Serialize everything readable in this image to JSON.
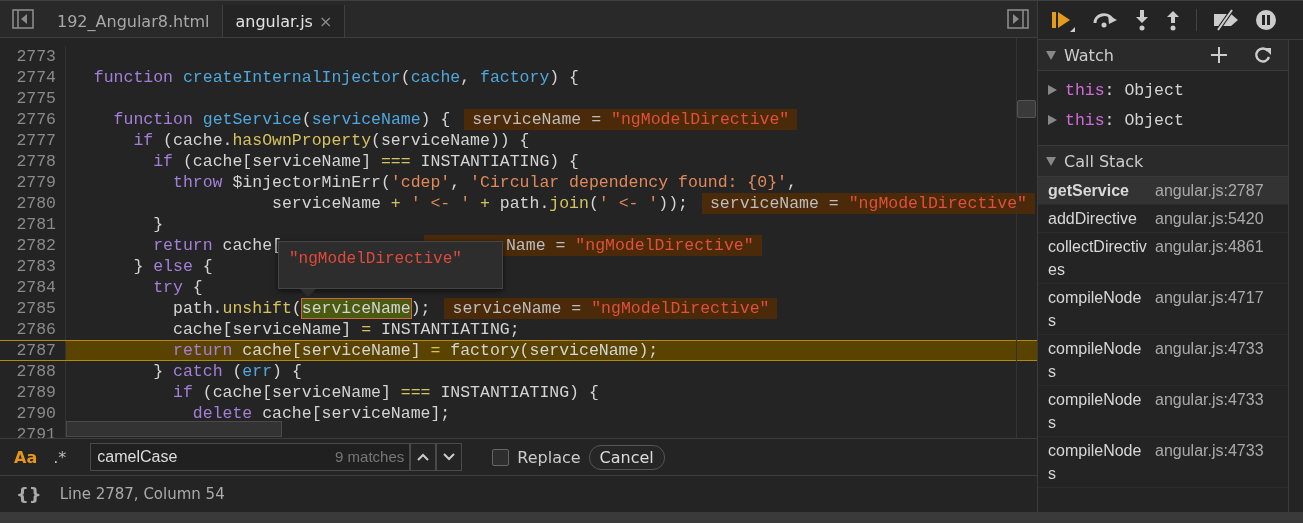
{
  "tabs": [
    {
      "label": "192_Angular8.html",
      "selected": false
    },
    {
      "label": "angular.js",
      "selected": true,
      "close": "×"
    }
  ],
  "editor": {
    "lines": [
      {
        "number": "2773"
      },
      {
        "number": "2774",
        "tokens": [
          {
            "kind": "kw",
            "text": "  function "
          },
          {
            "kind": "def",
            "text": "createInternalInjector"
          },
          {
            "kind": "plain",
            "text": "("
          },
          {
            "kind": "def",
            "text": "cache"
          },
          {
            "kind": "plain",
            "text": ", "
          },
          {
            "kind": "def",
            "text": "factory"
          },
          {
            "kind": "plain",
            "text": ") {"
          }
        ]
      },
      {
        "number": "2775"
      },
      {
        "number": "2776",
        "tokens": [
          {
            "kind": "kw",
            "text": "    function "
          },
          {
            "kind": "def",
            "text": "getService"
          },
          {
            "kind": "plain",
            "text": "("
          },
          {
            "kind": "def",
            "text": "serviceName"
          },
          {
            "kind": "plain",
            "text": ") {"
          }
        ],
        "inline_value": {
          "name": "serviceName =",
          "value": "\"ngModelDirective\"",
          "covered": false
        }
      },
      {
        "number": "2777",
        "tokens": [
          {
            "kind": "kw",
            "text": "      if"
          },
          {
            "kind": "plain",
            "text": " (cache."
          },
          {
            "kind": "method",
            "text": "hasOwnProperty"
          },
          {
            "kind": "plain",
            "text": "(serviceName)) {"
          }
        ]
      },
      {
        "number": "2778",
        "tokens": [
          {
            "kind": "kw",
            "text": "        if"
          },
          {
            "kind": "plain",
            "text": " (cache[serviceName] "
          },
          {
            "kind": "op",
            "text": "==="
          },
          {
            "kind": "plain",
            "text": " INSTANTIATING) {"
          }
        ]
      },
      {
        "number": "2779",
        "tokens": [
          {
            "kind": "kw",
            "text": "          throw"
          },
          {
            "kind": "plain",
            "text": " $injectorMinErr("
          },
          {
            "kind": "str",
            "text": "'cdep'"
          },
          {
            "kind": "plain",
            "text": ", "
          },
          {
            "kind": "str",
            "text": "'Circular dependency found: {0}'"
          },
          {
            "kind": "plain",
            "text": ","
          }
        ]
      },
      {
        "number": "2780",
        "tokens": [
          {
            "kind": "plain",
            "text": "                    serviceName "
          },
          {
            "kind": "op",
            "text": "+"
          },
          {
            "kind": "str",
            "text": " ' <- '"
          },
          {
            "kind": "op",
            "text": " +"
          },
          {
            "kind": "plain",
            "text": " path."
          },
          {
            "kind": "method",
            "text": "join"
          },
          {
            "kind": "plain",
            "text": "("
          },
          {
            "kind": "str",
            "text": "' <- '"
          },
          {
            "kind": "plain",
            "text": "));"
          }
        ],
        "inline_value": {
          "name": "serviceName =",
          "value": "\"ngModelDirective\"",
          "covered": false
        }
      },
      {
        "number": "2781",
        "tokens": [
          {
            "kind": "plain",
            "text": "        }"
          }
        ]
      },
      {
        "number": "2782",
        "tokens": [
          {
            "kind": "kw",
            "text": "        return"
          },
          {
            "kind": "plain",
            "text": " cache["
          }
        ],
        "inline_value": {
          "name": "Name =",
          "value": "\"ngModelDirective\"",
          "covered": true
        }
      },
      {
        "number": "2783",
        "tokens": [
          {
            "kind": "plain",
            "text": "      } "
          },
          {
            "kind": "kw",
            "text": "else"
          },
          {
            "kind": "plain",
            "text": " {"
          }
        ]
      },
      {
        "number": "2784",
        "tokens": [
          {
            "kind": "kw",
            "text": "        try"
          },
          {
            "kind": "plain",
            "text": " {"
          }
        ]
      },
      {
        "number": "2785",
        "tokens": [
          {
            "kind": "plain",
            "text": "          path."
          },
          {
            "kind": "method",
            "text": "unshift"
          },
          {
            "kind": "plain",
            "text": "("
          },
          {
            "kind": "hover",
            "text": "serviceName"
          },
          {
            "kind": "plain",
            "text": ");"
          }
        ],
        "inline_value": {
          "name": "serviceName =",
          "value": "\"ngModelDirective\"",
          "covered": false
        }
      },
      {
        "number": "2786",
        "tokens": [
          {
            "kind": "plain",
            "text": "          cache[serviceName] "
          },
          {
            "kind": "op",
            "text": "="
          },
          {
            "kind": "plain",
            "text": " INSTANTIATING;"
          }
        ]
      },
      {
        "number": "2787",
        "paused": true,
        "tokens": [
          {
            "kind": "kw",
            "text": "          return"
          },
          {
            "kind": "plain",
            "text": " cache[serviceName] "
          },
          {
            "kind": "op",
            "text": "="
          },
          {
            "kind": "plain",
            "text": " factory(serviceName);"
          }
        ]
      },
      {
        "number": "2788",
        "tokens": [
          {
            "kind": "plain",
            "text": "        } "
          },
          {
            "kind": "kw",
            "text": "catch"
          },
          {
            "kind": "plain",
            "text": " ("
          },
          {
            "kind": "def",
            "text": "err"
          },
          {
            "kind": "plain",
            "text": ") {"
          }
        ]
      },
      {
        "number": "2789",
        "tokens": [
          {
            "kind": "kw",
            "text": "          if"
          },
          {
            "kind": "plain",
            "text": " (cache[serviceName] "
          },
          {
            "kind": "op",
            "text": "==="
          },
          {
            "kind": "plain",
            "text": " INSTANTIATING) {"
          }
        ]
      },
      {
        "number": "2790",
        "tokens": [
          {
            "kind": "kw",
            "text": "            delete"
          },
          {
            "kind": "plain",
            "text": " cache[serviceName];"
          }
        ]
      },
      {
        "number": "2791"
      }
    ],
    "tooltip": "\"ngModelDirective\""
  },
  "search": {
    "toggles": [
      {
        "label": "Aa",
        "selected": true
      },
      {
        "label": ".*",
        "selected": false
      }
    ],
    "query": "camelCase",
    "match_count": "9 matches",
    "replace": {
      "label": "Replace",
      "checked": false
    },
    "cancel": "Cancel"
  },
  "status_bar": {
    "pretty_print": "{}",
    "position": "Line 2787, Column 54"
  },
  "debugger_toolbar": [
    {
      "kind": "resume"
    },
    {
      "kind": "step-over"
    },
    {
      "kind": "step-into"
    },
    {
      "kind": "step-out"
    },
    {
      "kind": "separator"
    },
    {
      "kind": "deactivate"
    },
    {
      "kind": "pause-exceptions"
    }
  ],
  "watch": {
    "title": "Watch",
    "expanded": true,
    "items": [
      {
        "name": "this",
        "value": ": Object",
        "expanded": false
      },
      {
        "name": "this",
        "value": ": Object",
        "expanded": false
      }
    ]
  },
  "call_stack": {
    "title": "Call Stack",
    "expanded": true,
    "frames": [
      {
        "function": "getService",
        "location": "angular.js:2787",
        "selected": true
      },
      {
        "function": "addDirective",
        "location": "angular.js:5420",
        "selected": false
      },
      {
        "function": "collectDirectives",
        "location": "angular.js:4861",
        "selected": false
      },
      {
        "function": "compileNodes",
        "location": "angular.js:4717",
        "selected": false
      },
      {
        "function": "compileNodes",
        "location": "angular.js:4733",
        "selected": false
      },
      {
        "function": "compileNodes",
        "location": "angular.js:4733",
        "selected": false
      },
      {
        "function": "compileNodes",
        "location": "angular.js:4733",
        "selected": false
      }
    ]
  }
}
